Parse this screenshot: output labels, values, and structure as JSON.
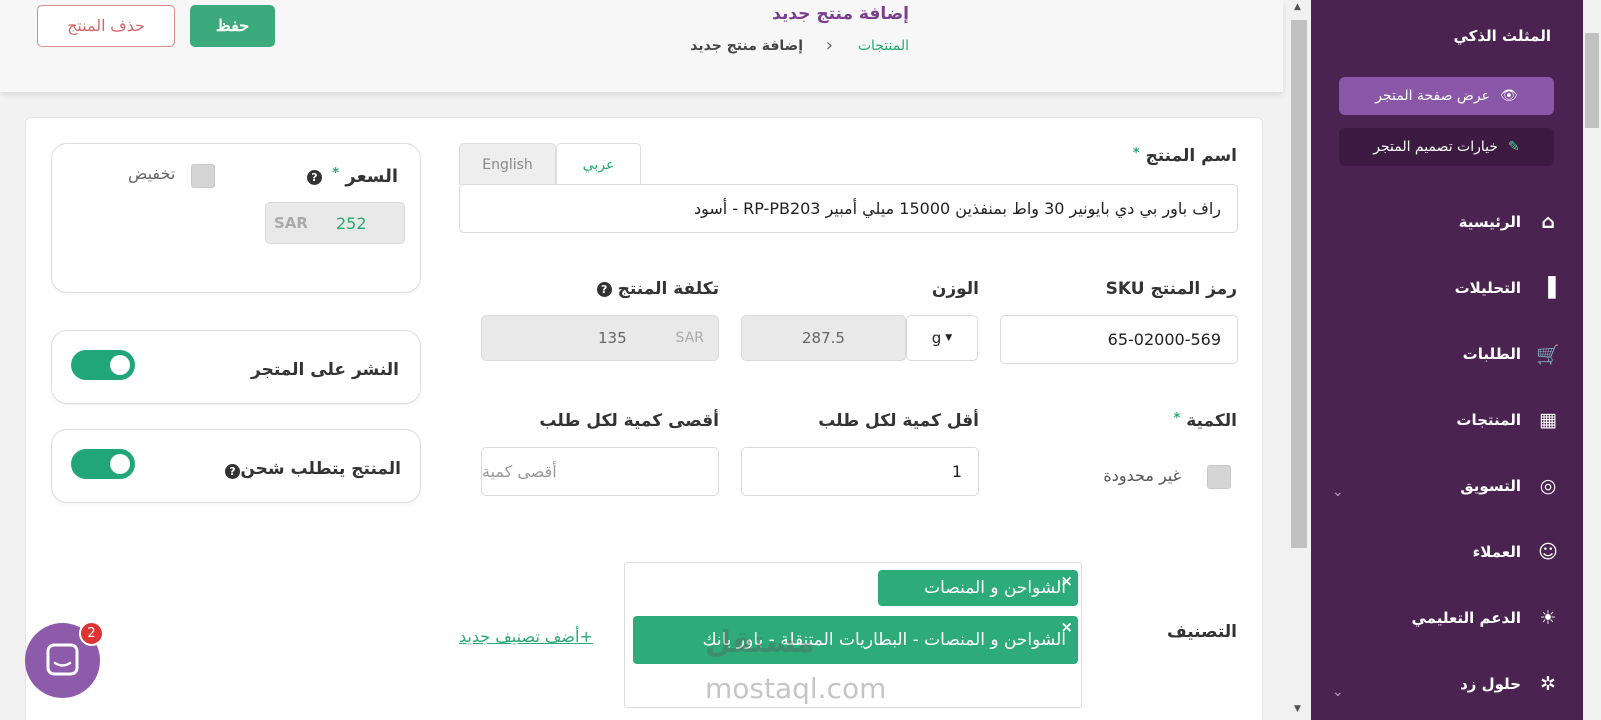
{
  "header": {
    "title": "إضافة منتج جديد",
    "breadcrumb": {
      "parent": "المنتجات",
      "separator": "›",
      "current": "إضافة منتج جديد"
    },
    "save_label": "حفظ",
    "delete_label": "حذف المنتج"
  },
  "form": {
    "name": {
      "label": "اسم المنتج",
      "required_mark": "*",
      "tabs": {
        "arabic": "عربي",
        "english": "English"
      },
      "value": "راف باور بي دي بايونير 30 واط بمنفذين 15000 ميلي أمبير RP-PB203 - أسود"
    },
    "sku": {
      "label": "رمز المنتج SKU",
      "value": "65-02000-569"
    },
    "weight": {
      "label": "الوزن",
      "value": "287.5",
      "unit": "g"
    },
    "cost": {
      "label": "تكلفة المنتج",
      "currency": "SAR",
      "value": "135"
    },
    "quantity": {
      "label": "الكمية",
      "required_mark": "*",
      "unlimited_label": "غير محدودة"
    },
    "min_qty": {
      "label": "أقل كمية لكل طلب",
      "value": "1"
    },
    "max_qty": {
      "label": "أقصى كمية لكل طلب",
      "placeholder": "أقصى كمية"
    },
    "category": {
      "label": "التصنيف",
      "tags": [
        "الشواحن و المنصات",
        "الشواحن و المنصات - البطاريات المتنقلة - باور بانك"
      ],
      "add_link": "+أضف تصنيف جديد"
    }
  },
  "price_panel": {
    "label": "السعر",
    "required_mark": "*",
    "discount_label": "تخفيض",
    "currency": "SAR",
    "value": "252"
  },
  "publish_panel": {
    "label": "النشر على المتجر",
    "enabled": true
  },
  "shipping_panel": {
    "label": "المنتج يتطلب شحن",
    "enabled": true
  },
  "sidebar": {
    "brand": "المثلث الذكي",
    "store_button": "عرض صفحة المتجر",
    "design_button": "خيارات تصميم المتجر",
    "items": [
      {
        "label": "الرئيسية",
        "icon": "home-icon"
      },
      {
        "label": "التحليلات",
        "icon": "bar-chart-icon"
      },
      {
        "label": "الطلبات",
        "icon": "cart-icon"
      },
      {
        "label": "المنتجات",
        "icon": "grid-icon"
      },
      {
        "label": "التسويق",
        "icon": "target-icon"
      },
      {
        "label": "العملاء",
        "icon": "user-icon"
      },
      {
        "label": "الدعم التعليمي",
        "icon": "lightbulb-icon"
      },
      {
        "label": "حلول زد",
        "icon": "gear-icon"
      }
    ]
  },
  "chat": {
    "badge_count": "2"
  },
  "watermark": {
    "line1": "مستقل",
    "line2": "mostaql.com"
  },
  "colors": {
    "accent_green": "#2aa874",
    "sidebar_purple": "#4a2350",
    "title_purple": "#7a3f8f"
  }
}
